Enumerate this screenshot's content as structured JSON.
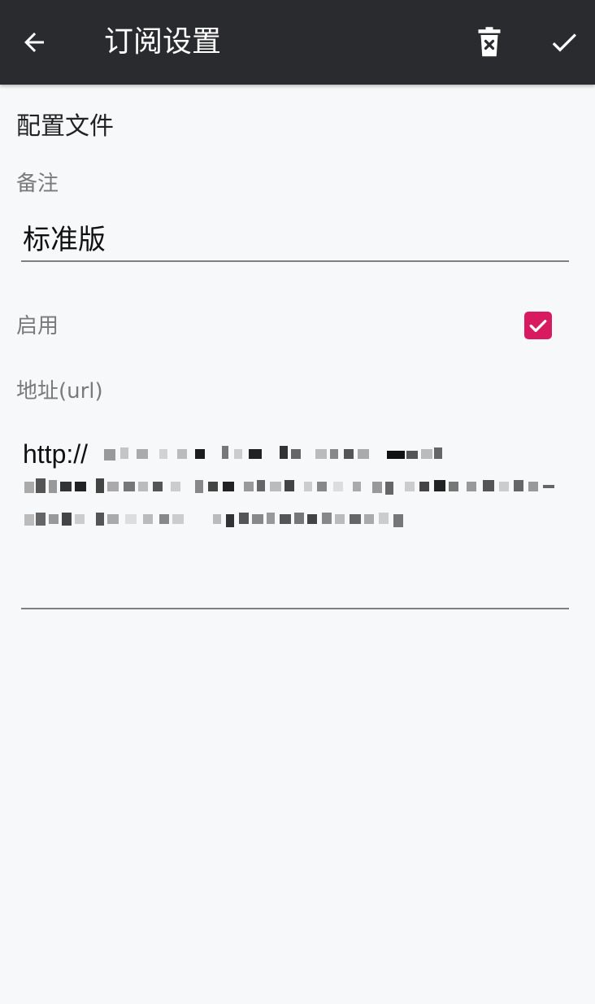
{
  "toolbar": {
    "back_icon": "arrow-left-icon",
    "title": "订阅设置",
    "delete_icon": "trash-can-x-icon",
    "confirm_icon": "checkmark-icon",
    "background_color": "#2a2b2e"
  },
  "profile": {
    "section_title": "配置文件",
    "remark_label": "备注",
    "remark_value": "标准版",
    "enabled_label": "启用",
    "enabled": true,
    "enabled_color": "#d81b60",
    "url_label": "地址(url)",
    "url_value_visible_prefix": "http://"
  }
}
